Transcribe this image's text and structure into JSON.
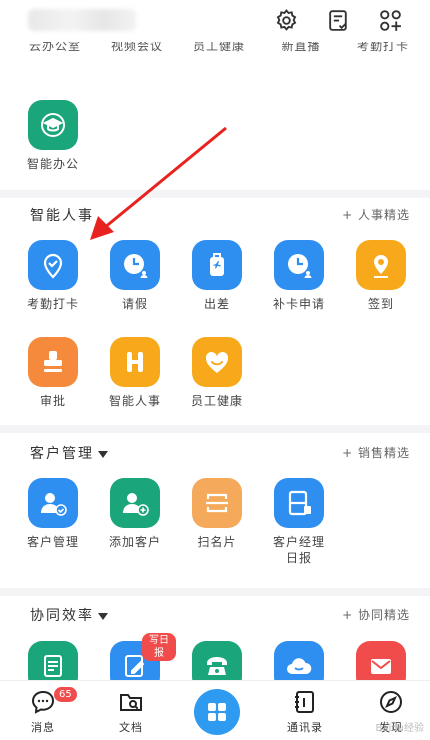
{
  "topbar": {
    "icons": [
      "gear-icon",
      "task-list-icon",
      "grid-add-icon"
    ]
  },
  "cut_row": {
    "labels": [
      "云办公室",
      "视频会议",
      "员工健康",
      "新直播",
      "考勤打卡"
    ]
  },
  "smart_office": {
    "label": "智能办公",
    "color": "#1aa57a"
  },
  "hr": {
    "title": "智能人事",
    "link": "+ 人事精选",
    "apps": [
      {
        "label": "考勤打卡",
        "icon": "location-check-icon",
        "color": "#2f8ff0"
      },
      {
        "label": "请假",
        "icon": "clock-user-icon",
        "color": "#2f8ff0"
      },
      {
        "label": "出差",
        "icon": "suitcase-icon",
        "color": "#2f8ff0"
      },
      {
        "label": "补卡申请",
        "icon": "clock-user-icon",
        "color": "#2f8ff0"
      },
      {
        "label": "签到",
        "icon": "pin-icon",
        "color": "#f7a91b"
      },
      {
        "label": "审批",
        "icon": "stamp-icon",
        "color": "#f58a3c"
      },
      {
        "label": "智能人事",
        "icon": "h-letter-icon",
        "color": "#f7a91b"
      },
      {
        "label": "员工健康",
        "icon": "heart-icon",
        "color": "#f7a91b"
      }
    ]
  },
  "crm": {
    "title": "客户管理",
    "link": "+ 销售精选",
    "apps": [
      {
        "label": "客户管理",
        "icon": "customer-check-icon",
        "color": "#2f8ff0"
      },
      {
        "label": "添加客户",
        "icon": "customer-add-icon",
        "color": "#1aa57a"
      },
      {
        "label": "扫名片",
        "icon": "scan-card-icon",
        "color": "#f58a3c"
      },
      {
        "label": "客户经理",
        "label2": "日报",
        "icon": "report-icon",
        "color": "#2f8ff0"
      }
    ]
  },
  "collab": {
    "title": "协同效率",
    "link": "+ 协同精选",
    "badge": "写日报",
    "apps": [
      {
        "icon": "document-list-icon",
        "color": "#1aa57a"
      },
      {
        "icon": "edit-note-icon",
        "color": "#2f8ff0"
      },
      {
        "icon": "phone-icon",
        "color": "#1aa57a"
      },
      {
        "icon": "cloud-icon",
        "color": "#2f8ff0"
      },
      {
        "icon": "mail-icon",
        "color": "#f04c4c"
      }
    ]
  },
  "nav": {
    "messages": "消息",
    "messages_badge": "65",
    "docs": "文档",
    "contacts": "通讯录",
    "discover": "发现"
  },
  "watermark": "Baidu经验"
}
